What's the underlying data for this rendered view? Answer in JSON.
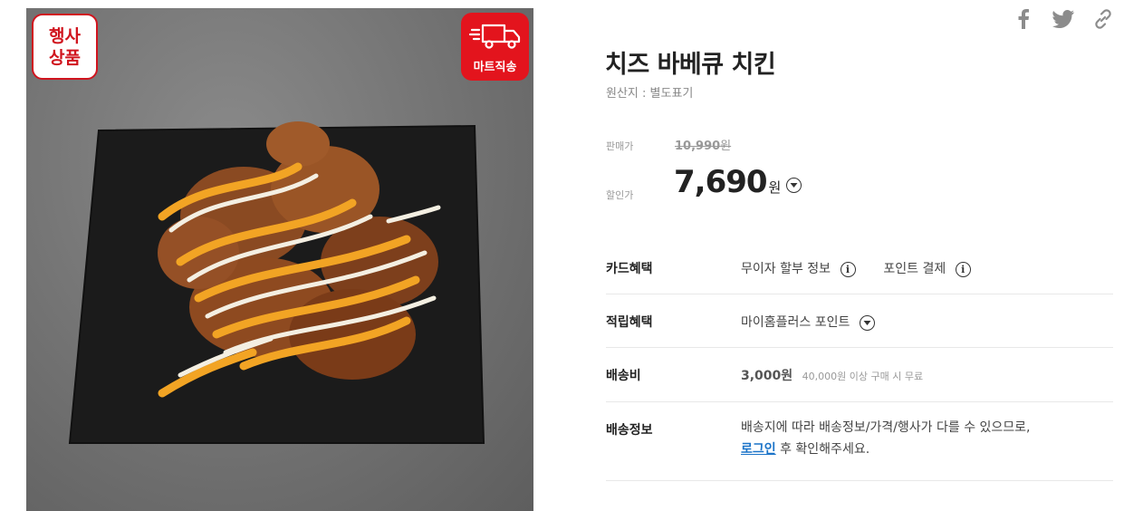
{
  "product_image": {
    "badge_event_line1": "행사",
    "badge_event_line2": "상품",
    "badge_mart": "마트직송",
    "accent_color": "#e3141d"
  },
  "share_icons": [
    "facebook-icon",
    "twitter-icon",
    "link-icon"
  ],
  "product": {
    "title": "치즈 바베큐 치킨",
    "origin": "원산지 : 별도표기"
  },
  "price": {
    "original_label": "판매가",
    "original_value": "10,990",
    "original_unit": "원",
    "sale_label": "할인가",
    "sale_value": "7,690",
    "sale_unit": "원"
  },
  "benefits": {
    "card_label": "카드혜택",
    "card_item1": "무이자 할부 정보",
    "card_item2": "포인트 결제",
    "reward_label": "적립혜택",
    "reward_item": "마이홈플러스 포인트",
    "shipping_fee_label": "배송비",
    "shipping_fee_value": "3,000원",
    "shipping_fee_note": "40,000원 이상 구매 시 무료",
    "shipping_info_label": "배송정보",
    "shipping_info_line1": "배송지에 따라 배송정보/가격/행사가 다를 수 있으므로,",
    "shipping_info_link": "로그인",
    "shipping_info_line2_rest": " 후 확인해주세요."
  }
}
